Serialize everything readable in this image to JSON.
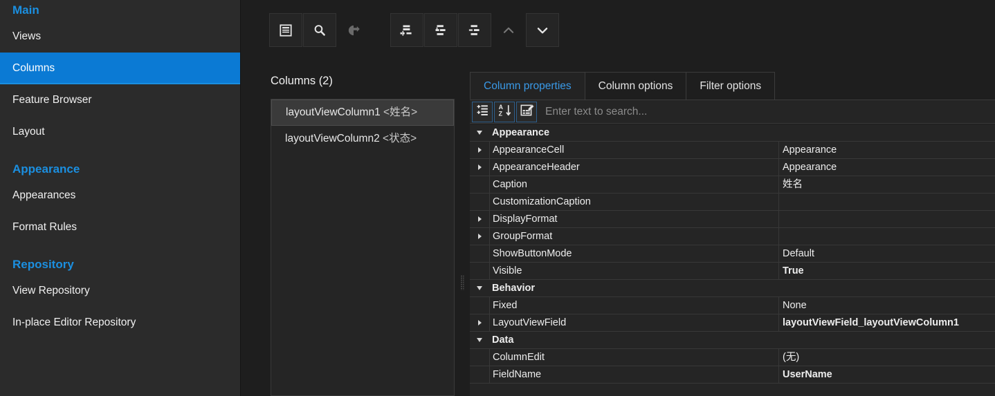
{
  "sidebar": {
    "groups": [
      {
        "title": "Main",
        "items": [
          {
            "label": "Views",
            "selected": false
          },
          {
            "label": "Columns",
            "selected": true
          },
          {
            "label": "Feature Browser",
            "selected": false
          },
          {
            "label": "Layout",
            "selected": false
          }
        ]
      },
      {
        "title": "Appearance",
        "items": [
          {
            "label": "Appearances",
            "selected": false
          },
          {
            "label": "Format Rules",
            "selected": false
          }
        ]
      },
      {
        "title": "Repository",
        "items": [
          {
            "label": "View Repository",
            "selected": false
          },
          {
            "label": "In-place Editor Repository",
            "selected": false
          }
        ]
      }
    ]
  },
  "toolbar": {
    "buttons": [
      {
        "icon": "properties-list-icon",
        "name": "show-properties-button",
        "disabled": false,
        "flat": false
      },
      {
        "icon": "search-icon",
        "name": "find-button",
        "disabled": false,
        "flat": false
      },
      {
        "icon": "export-icon",
        "name": "export-button",
        "disabled": true,
        "flat": true
      },
      {
        "icon": "add-node-icon",
        "name": "add-item-button",
        "disabled": false,
        "flat": false
      },
      {
        "icon": "add-child-node-icon",
        "name": "add-child-button",
        "disabled": false,
        "flat": false
      },
      {
        "icon": "remove-node-icon",
        "name": "remove-item-button",
        "disabled": false,
        "flat": false
      },
      {
        "icon": "chevron-up-icon",
        "name": "move-up-button",
        "disabled": true,
        "flat": true
      },
      {
        "icon": "chevron-down-icon",
        "name": "move-down-button",
        "disabled": false,
        "flat": false
      }
    ]
  },
  "columns_panel": {
    "title": "Columns (2)",
    "items": [
      {
        "name": "layoutViewColumn1",
        "caption": "<姓名>",
        "selected": true
      },
      {
        "name": "layoutViewColumn2",
        "caption": "<状态>",
        "selected": false
      }
    ]
  },
  "properties_panel": {
    "tabs": [
      {
        "label": "Column properties",
        "active": true
      },
      {
        "label": "Column options",
        "active": false
      },
      {
        "label": "Filter options",
        "active": false
      }
    ],
    "toolbar_buttons": [
      {
        "icon": "categorized-icon",
        "name": "categorized-sort-button"
      },
      {
        "icon": "alphabetical-sort-icon",
        "name": "alphabetical-sort-button"
      },
      {
        "icon": "property-pages-icon",
        "name": "property-pages-button"
      }
    ],
    "search": {
      "placeholder": "Enter text to search...",
      "value": ""
    },
    "rows": [
      {
        "kind": "category",
        "expander": "down",
        "name": "Appearance",
        "value": "",
        "bold_value": false
      },
      {
        "kind": "prop",
        "expander": "right",
        "name": "AppearanceCell",
        "value": "Appearance",
        "bold_value": false
      },
      {
        "kind": "prop",
        "expander": "right",
        "name": "AppearanceHeader",
        "value": "Appearance",
        "bold_value": false
      },
      {
        "kind": "prop",
        "expander": "none",
        "name": "Caption",
        "value": "姓名",
        "bold_value": false
      },
      {
        "kind": "prop",
        "expander": "none",
        "name": "CustomizationCaption",
        "value": "",
        "bold_value": false
      },
      {
        "kind": "prop",
        "expander": "right",
        "name": "DisplayFormat",
        "value": "",
        "bold_value": false
      },
      {
        "kind": "prop",
        "expander": "right",
        "name": "GroupFormat",
        "value": "",
        "bold_value": false
      },
      {
        "kind": "prop",
        "expander": "none",
        "name": "ShowButtonMode",
        "value": "Default",
        "bold_value": false
      },
      {
        "kind": "prop",
        "expander": "none",
        "name": "Visible",
        "value": "True",
        "bold_value": true
      },
      {
        "kind": "category",
        "expander": "down",
        "name": "Behavior",
        "value": "",
        "bold_value": false
      },
      {
        "kind": "prop",
        "expander": "none",
        "name": "Fixed",
        "value": "None",
        "bold_value": false
      },
      {
        "kind": "prop",
        "expander": "right",
        "name": "LayoutViewField",
        "value": "layoutViewField_layoutViewColumn1",
        "bold_value": true
      },
      {
        "kind": "category",
        "expander": "down",
        "name": "Data",
        "value": "",
        "bold_value": false
      },
      {
        "kind": "prop",
        "expander": "none",
        "name": "ColumnEdit",
        "value": "(无)",
        "bold_value": false
      },
      {
        "kind": "prop",
        "expander": "none",
        "name": "FieldName",
        "value": "UserName",
        "bold_value": true
      }
    ]
  },
  "colors": {
    "accent": "#1b8fe0",
    "selection": "#0b7ad4",
    "sidebar_bg": "#2b2b2b",
    "panel_bg": "#252525",
    "app_bg": "#1e1e1e",
    "tab_active_text": "#3a9ae8"
  }
}
